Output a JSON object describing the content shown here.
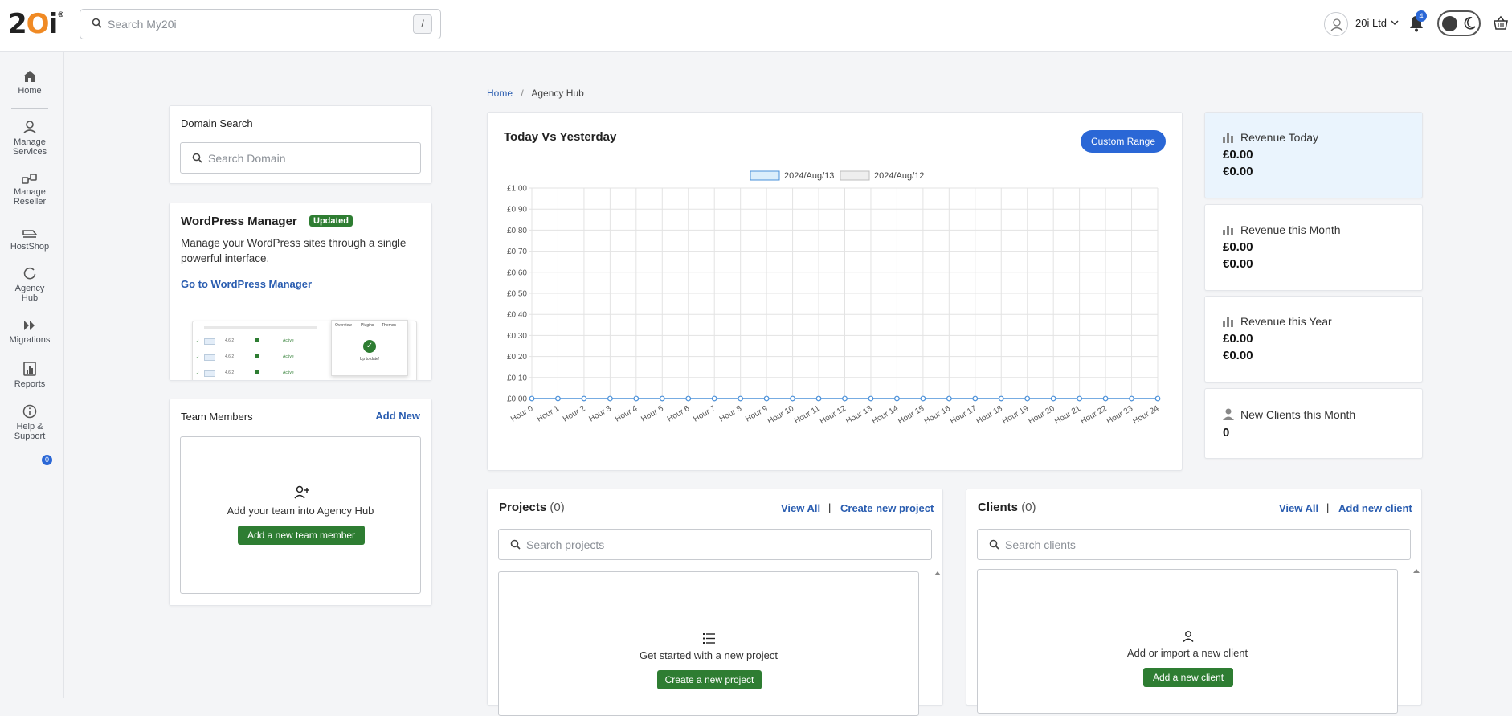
{
  "header": {
    "logo_text": "20i",
    "logo_mark": "®",
    "search_placeholder": "Search My20i",
    "search_shortcut": "/",
    "account_name": "20i Ltd",
    "notification_count": "4"
  },
  "sidebar": {
    "items": [
      {
        "label_lines": [
          "Home"
        ],
        "icon": "home-icon"
      },
      {
        "label_lines": [
          "Manage",
          "Services"
        ],
        "icon": "manage-services-icon"
      },
      {
        "label_lines": [
          "Manage",
          "Reseller"
        ],
        "icon": "manage-reseller-icon"
      },
      {
        "label_lines": [
          "HostShop"
        ],
        "icon": "hostshop-icon"
      },
      {
        "label_lines": [
          "Agency",
          "Hub"
        ],
        "icon": "agency-hub-icon"
      },
      {
        "label_lines": [
          "Migrations"
        ],
        "icon": "migrations-icon"
      },
      {
        "label_lines": [
          "Reports"
        ],
        "icon": "reports-icon"
      },
      {
        "label_lines": [
          "Help &",
          "Support"
        ],
        "icon": "help-icon"
      }
    ],
    "help_badge": "0"
  },
  "breadcrumb": {
    "home": "Home",
    "separator": "/",
    "current": "Agency Hub"
  },
  "domain_search": {
    "title": "Domain Search",
    "placeholder": "Search Domain"
  },
  "wordpress": {
    "title": "WordPress Manager",
    "badge": "Updated",
    "description": "Manage your WordPress sites through a single powerful interface.",
    "link": "Go to WordPress Manager",
    "preview_tabs": [
      "Overview",
      "Plugins",
      "Themes"
    ],
    "preview_status": "Up to date!",
    "preview_row_status": "Active"
  },
  "team": {
    "title": "Team Members",
    "add_link": "Add New",
    "empty_text": "Add your team into Agency Hub",
    "button": "Add a new team member"
  },
  "chart_panel": {
    "title": "Today Vs Yesterday",
    "button": "Custom Range"
  },
  "chart_data": {
    "type": "line",
    "title": "Today Vs Yesterday",
    "categories": [
      "Hour 0",
      "Hour 1",
      "Hour 2",
      "Hour 3",
      "Hour 4",
      "Hour 5",
      "Hour 6",
      "Hour 7",
      "Hour 8",
      "Hour 9",
      "Hour 10",
      "Hour 11",
      "Hour 12",
      "Hour 13",
      "Hour 14",
      "Hour 15",
      "Hour 16",
      "Hour 17",
      "Hour 18",
      "Hour 19",
      "Hour 20",
      "Hour 21",
      "Hour 22",
      "Hour 23",
      "Hour 24"
    ],
    "series": [
      {
        "name": "2024/Aug/13",
        "color": "#4a90d9",
        "fill": "#dbeefb",
        "values": [
          0,
          0,
          0,
          0,
          0,
          0,
          0,
          0,
          0,
          0,
          0,
          0,
          0,
          0,
          0,
          0,
          0,
          0,
          0,
          0,
          0,
          0,
          0,
          0,
          0
        ]
      },
      {
        "name": "2024/Aug/12",
        "color": "#bdbdbd",
        "fill": "#eeeeee",
        "values": []
      }
    ],
    "y_ticks": [
      "£0.00",
      "£0.10",
      "£0.20",
      "£0.30",
      "£0.40",
      "£0.50",
      "£0.60",
      "£0.70",
      "£0.80",
      "£0.90",
      "£1.00"
    ],
    "ylim": [
      0,
      1
    ],
    "grid": true,
    "legend": "top-center"
  },
  "stats": [
    {
      "label": "Revenue Today",
      "values": [
        "£0.00",
        "€0.00"
      ],
      "icon": "bar-chart-icon",
      "highlight": true
    },
    {
      "label": "Revenue this Month",
      "values": [
        "£0.00",
        "€0.00"
      ],
      "icon": "bar-chart-icon",
      "highlight": false
    },
    {
      "label": "Revenue this Year",
      "values": [
        "£0.00",
        "€0.00"
      ],
      "icon": "bar-chart-icon",
      "highlight": false
    },
    {
      "label": "New Clients this Month",
      "values": [
        "0"
      ],
      "icon": "person-icon",
      "highlight": false
    }
  ],
  "projects": {
    "title": "Projects",
    "count": "(0)",
    "view_all": "View All",
    "divider": "|",
    "create_link": "Create new project",
    "search_placeholder": "Search projects",
    "empty_text": "Get started with a new project",
    "button": "Create a new project"
  },
  "clients": {
    "title": "Clients",
    "count": "(0)",
    "view_all": "View All",
    "divider": "|",
    "create_link": "Add new client",
    "search_placeholder": "Search clients",
    "empty_text": "Add or import a new client",
    "button": "Add a new client"
  },
  "colors": {
    "accent_blue": "#2a67d6",
    "green": "#2e7d32",
    "logo_orange": "#f08a24",
    "highlight_card": "#eaf4fd"
  }
}
